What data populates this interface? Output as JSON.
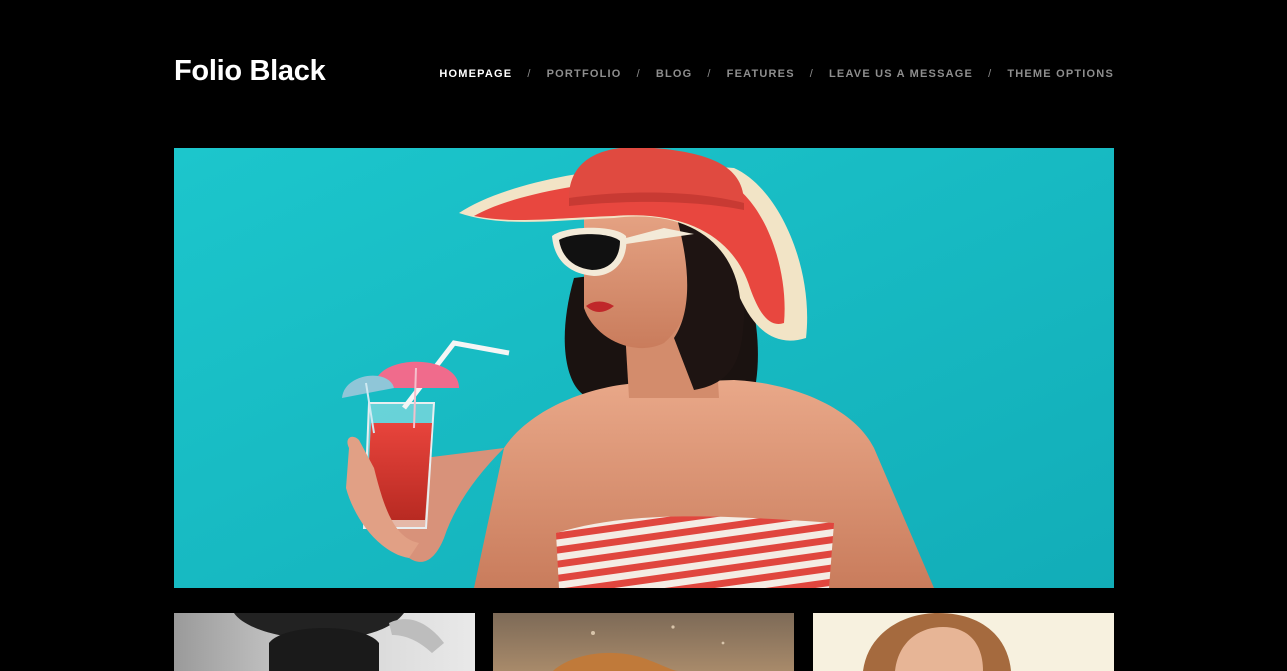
{
  "site": {
    "title": "Folio Black"
  },
  "nav": {
    "items": [
      {
        "label": "HOMEPAGE",
        "active": true
      },
      {
        "label": "PORTFOLIO",
        "active": false
      },
      {
        "label": "BLOG",
        "active": false
      },
      {
        "label": "FEATURES",
        "active": false
      },
      {
        "label": "LEAVE US A MESSAGE",
        "active": false
      },
      {
        "label": "THEME OPTIONS",
        "active": false
      }
    ],
    "separator": "/"
  },
  "hero": {
    "icon": "featured-photo"
  },
  "thumbnails": [
    {
      "icon": "portfolio-thumb-bw"
    },
    {
      "icon": "portfolio-thumb-sand"
    },
    {
      "icon": "portfolio-thumb-portrait"
    }
  ],
  "colors": {
    "background": "#000000",
    "nav_active": "#ffffff",
    "nav_inactive": "#8e8e8e",
    "hero_bg": "#19bdc4"
  }
}
